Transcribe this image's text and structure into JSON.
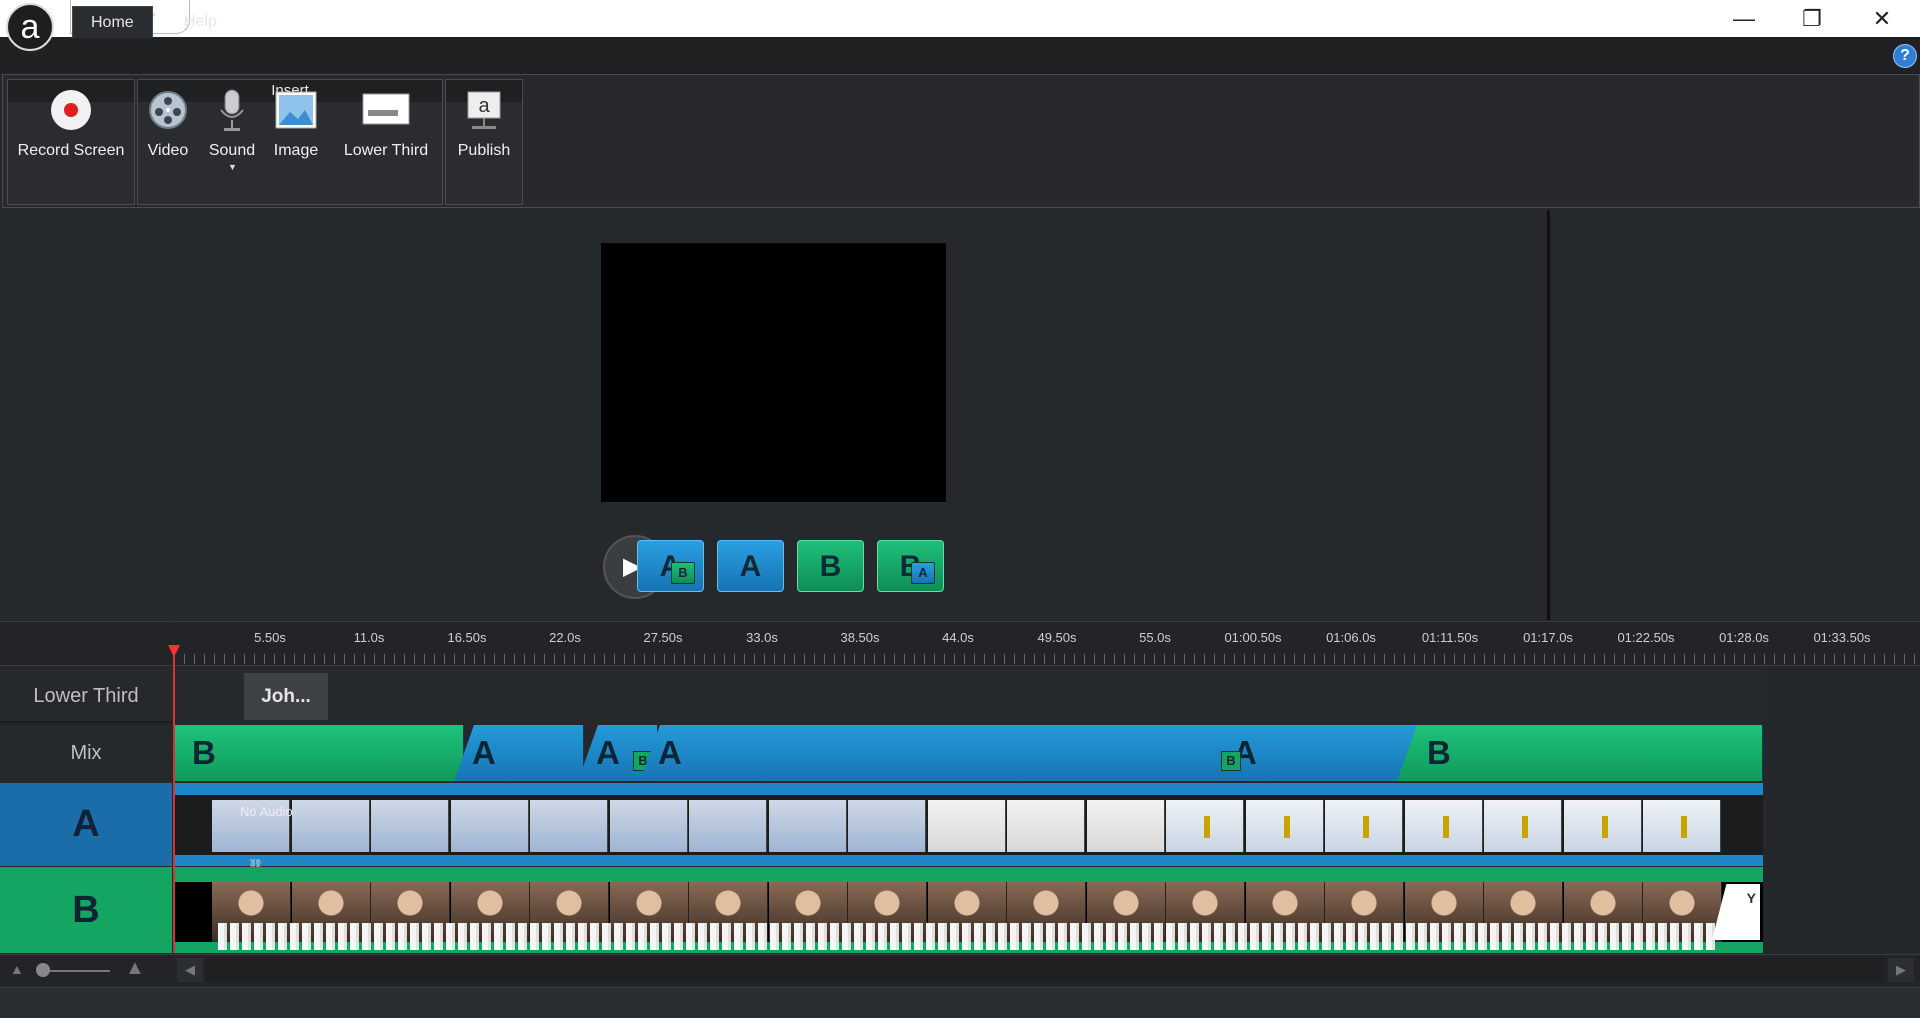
{
  "app": {
    "logo_letter": "a"
  },
  "quick_access": {
    "save_icon": "save-icon",
    "undo_icon": "undo-icon",
    "redo_icon": "redo-icon"
  },
  "window_controls": {
    "minimize": "—",
    "restore": "❐",
    "close": "✕"
  },
  "tabs": [
    {
      "label": "Home"
    },
    {
      "label": "Help"
    }
  ],
  "help_glyph": "?",
  "ribbon": {
    "record": {
      "label": "Record Screen"
    },
    "insert_group": {
      "label": "Insert",
      "buttons": [
        {
          "label": "Video"
        },
        {
          "label": "Sound"
        },
        {
          "label": "Image"
        },
        {
          "label": "Lower Third"
        }
      ]
    },
    "publish": {
      "label": "Publish"
    }
  },
  "layout_buttons": [
    {
      "main": "A",
      "mini": "B"
    },
    {
      "main": "A"
    },
    {
      "main": "B"
    },
    {
      "main": "B",
      "mini": "A"
    }
  ],
  "ruler": {
    "ticks": [
      "5.50s",
      "11.0s",
      "16.50s",
      "22.0s",
      "27.50s",
      "33.0s",
      "38.50s",
      "44.0s",
      "49.50s",
      "55.0s",
      "01:00.50s",
      "01:06.0s",
      "01:11.50s",
      "01:17.0s",
      "01:22.50s",
      "01:28.0s",
      "01:33.50s"
    ]
  },
  "tracks": {
    "lower_third": {
      "label": "Lower Third",
      "clip": "Joh..."
    },
    "mix": {
      "label": "Mix",
      "segments": [
        "B",
        "A",
        "A",
        "A",
        "A",
        "B"
      ],
      "segment_minis": {
        "2": "B",
        "4": "B"
      }
    },
    "a": {
      "label": "A",
      "no_audio": "No Audio"
    },
    "b": {
      "label": "B",
      "endcard": "Y"
    }
  },
  "colors": {
    "track_a": "#1f86c9",
    "track_b": "#14a563",
    "playhead": "#e03030"
  }
}
